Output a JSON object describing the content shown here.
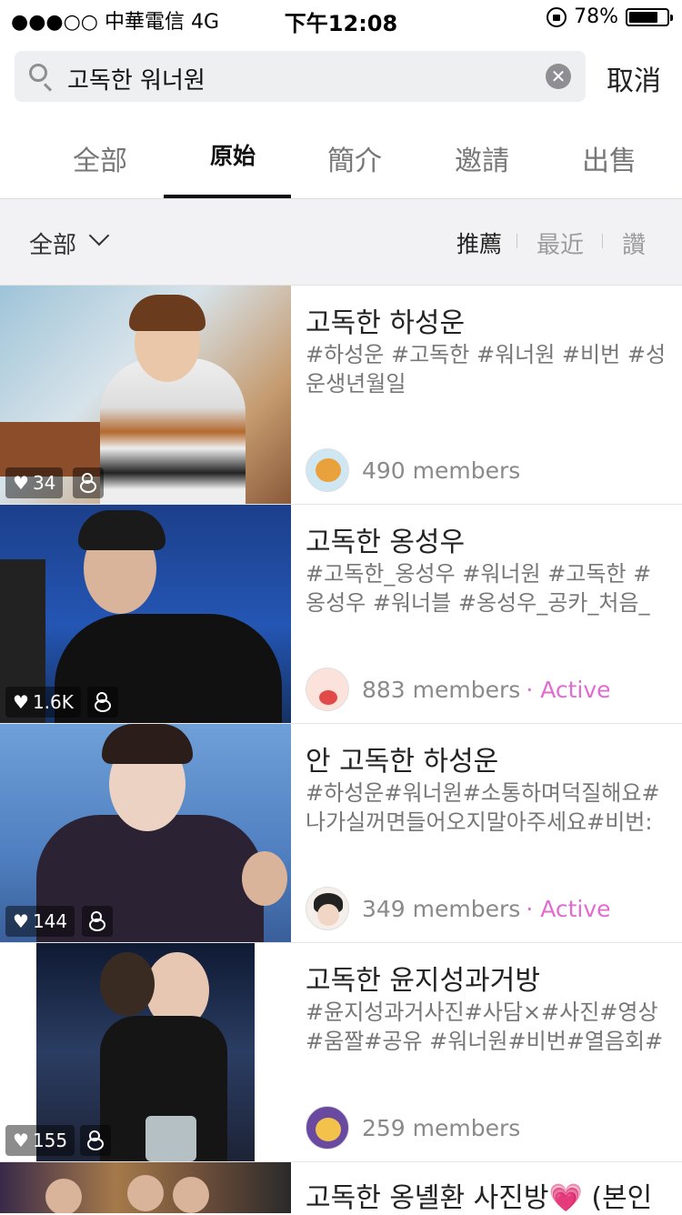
{
  "status_bar": {
    "carrier": "●●●○○ 中華電信   4G",
    "time": "下午12:08",
    "battery": "78%",
    "battery_fraction": 0.78
  },
  "search": {
    "query": "고독한 워너원",
    "cancel_label": "取消"
  },
  "tabs": [
    "全部",
    "原始",
    "簡介",
    "邀請",
    "出售"
  ],
  "active_tab_index": 1,
  "filter": {
    "scope": "全部",
    "sort_options": [
      "推薦",
      "最近",
      "讚"
    ],
    "active_sort_index": 0
  },
  "results": [
    {
      "title": "고독한 하성운",
      "tags": "#하성운 #고독한 #워너원 #비번  #성운생년월일",
      "likes": "34",
      "members": "490 members",
      "active": ""
    },
    {
      "title": "고독한 옹성우",
      "tags": "#고독한_옹성우 #워너원 #고독한 #옹성우 #워너블 #옹성우_공카_처음_글...",
      "likes": "1.6K",
      "members": "883 members",
      "active": "· Active"
    },
    {
      "title": "안 고독한 하성운",
      "tags": "#하성운#워너원#소통하며덕질해요#나가실꺼면들어오지말아주세요#비번:(...",
      "likes": "144",
      "members": "349 members",
      "active": "· Active"
    },
    {
      "title": "고독한 윤지성과거방",
      "tags": "#윤지성과거사진#사담×#사진#영상#움짤#공유 #워너원#비번#열음회#활...",
      "likes": "155",
      "members": "259 members",
      "active": ""
    },
    {
      "title": "고독한 옹녤환 사진방💗 (본인",
      "tags": "",
      "likes": "",
      "members": "",
      "active": ""
    }
  ],
  "colors": {
    "active_accent": "#e26bd0",
    "filter_bar_bg": "#f2f2f4",
    "search_bg": "#eeeff1"
  }
}
